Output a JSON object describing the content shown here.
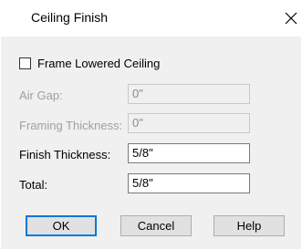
{
  "window": {
    "title": "Ceiling Finish",
    "close_icon": "close-icon"
  },
  "frame_lowered": {
    "label": "Frame Lowered Ceiling",
    "checked": false
  },
  "fields": {
    "air_gap": {
      "label": "Air Gap:",
      "value": "0\""
    },
    "framing_thickness": {
      "label": "Framing Thickness:",
      "value": "0\""
    },
    "finish_thickness": {
      "label": "Finish Thickness:",
      "value": "5/8\""
    },
    "total": {
      "label": "Total:",
      "value": "5/8\""
    }
  },
  "buttons": {
    "ok": "OK",
    "cancel": "Cancel",
    "help": "Help"
  }
}
